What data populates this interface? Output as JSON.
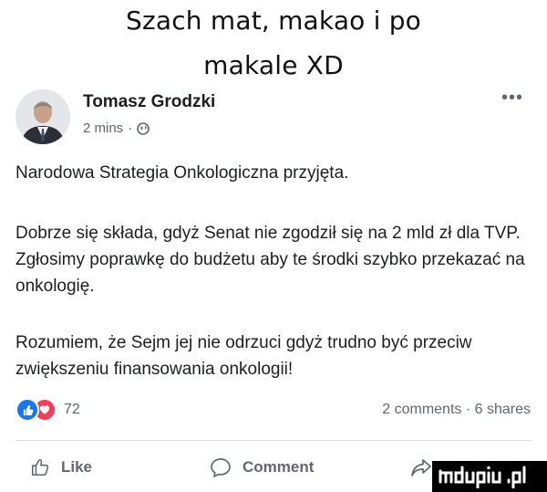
{
  "caption": {
    "line1": "Szach mat, makao i po",
    "line2": "makale XD"
  },
  "post": {
    "author": "Tomasz Grodzki",
    "time": "2 mins",
    "separator": "·",
    "privacy_icon": "globe-icon",
    "more": "•••",
    "paragraphs": [
      "Narodowa Strategia Onkologiczna przyjęta.",
      "Dobrze się składa, gdyż Senat nie zgodził się na 2 mld zł dla TVP. Zgłosimy poprawkę do budżetu aby te środki szybko przekazać na onkologię.",
      "Rozumiem, że Sejm jej nie odrzuci gdyż trudno być przeciw zwiększeniu finansowania onkologii!"
    ]
  },
  "reactions": {
    "icons": [
      "like-reaction-icon",
      "love-reaction-icon"
    ],
    "count": "72"
  },
  "stats": {
    "comments": "2 comments",
    "separator": "·",
    "shares": "6 shares"
  },
  "actions": {
    "like": "Like",
    "comment": "Comment"
  },
  "colors": {
    "like_blue": "#1877f2",
    "love_red": "#f33e58",
    "meta_gray": "#606770"
  }
}
